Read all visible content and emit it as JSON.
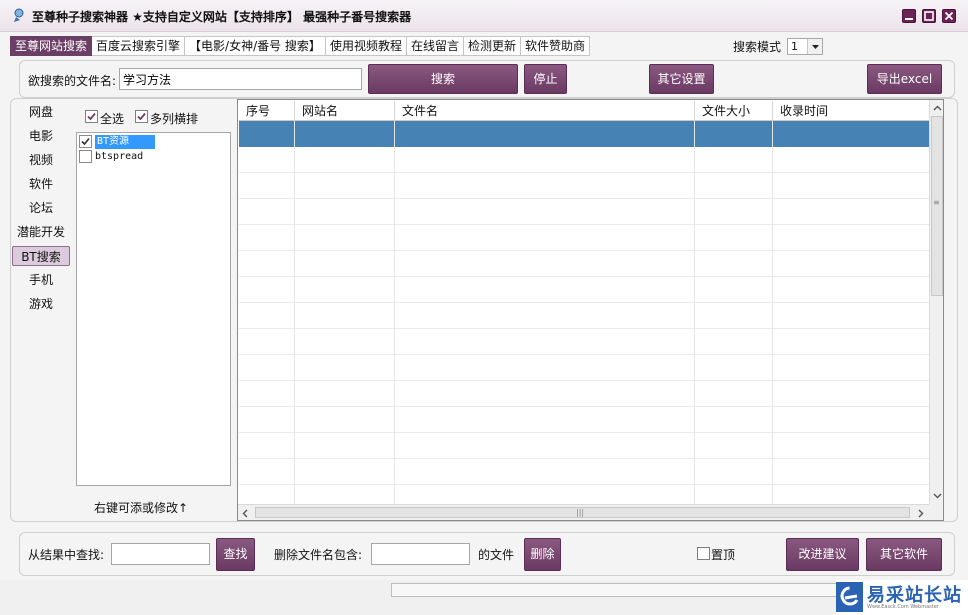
{
  "window": {
    "title": "至尊种子搜索神器  ★支持自定义网站【支持排序】 最强种子番号搜索器",
    "controls": [
      "minimize-icon",
      "maximize-icon",
      "close-icon"
    ]
  },
  "tabs": [
    {
      "label": "至尊网站搜索",
      "active": true
    },
    {
      "label": "百度云搜索引擎",
      "active": false
    },
    {
      "label": "【电影/女神/番号  搜索】",
      "active": false
    },
    {
      "label": "使用视频教程",
      "active": false
    },
    {
      "label": "在线留言",
      "active": false
    },
    {
      "label": "检测更新",
      "active": false
    },
    {
      "label": "软件赞助商",
      "active": false
    }
  ],
  "search_mode": {
    "label": "搜索模式",
    "value": "1"
  },
  "search_bar": {
    "label": "欲搜索的文件名:",
    "value": "学习方法",
    "buttons": {
      "search": "搜索",
      "stop": "停止",
      "settings": "其它设置",
      "export": "导出excel"
    }
  },
  "categories": [
    {
      "label": "网盘",
      "active": false
    },
    {
      "label": "电影",
      "active": false
    },
    {
      "label": "视频",
      "active": false
    },
    {
      "label": "软件",
      "active": false
    },
    {
      "label": "论坛",
      "active": false
    },
    {
      "label": "潜能开发",
      "active": false
    },
    {
      "label": "BT搜索",
      "active": true
    },
    {
      "label": "手机",
      "active": false
    },
    {
      "label": "游戏",
      "active": false
    }
  ],
  "source_options": {
    "select_all": "全选",
    "multi_column": "多列横排"
  },
  "sources": [
    {
      "label": "BT资源",
      "checked": true,
      "selected": true
    },
    {
      "label": "btspread",
      "checked": false,
      "selected": false
    }
  ],
  "sources_hint": "右键可添或修改↑",
  "table": {
    "columns": [
      "序号",
      "网站名",
      "文件名",
      "文件大小",
      "收录时间"
    ],
    "rows": []
  },
  "bottom_bar": {
    "find_label": "从结果中查找:",
    "find_value": "",
    "find_button": "查找",
    "delete_label": "删除文件名包含:",
    "delete_value": "",
    "delete_suffix": "的文件",
    "delete_button": "删除",
    "pin_label": "置顶",
    "pin_checked": false,
    "suggest_button": "改进建议",
    "other_button": "其它软件"
  },
  "watermark": {
    "text": "易采站长站",
    "sub": "Www.Easck.Com Webmaster"
  },
  "colors": {
    "accent": "#6b3e66",
    "button": "#7a4872",
    "selection": "#4682b4"
  }
}
